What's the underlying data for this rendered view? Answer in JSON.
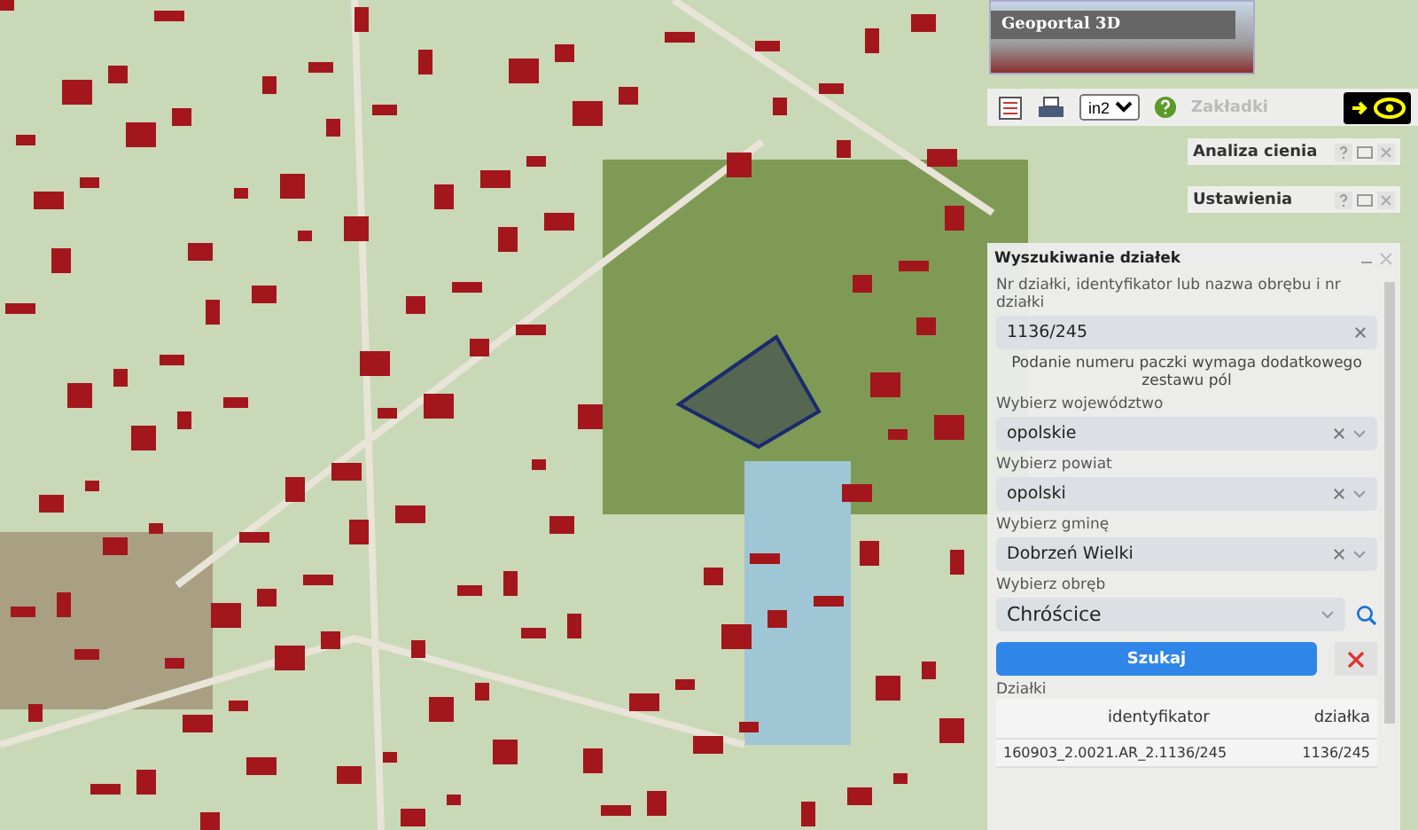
{
  "preview": {
    "title": "Geoportal 3D"
  },
  "toolbar": {
    "scale": "in2",
    "bookmarks_title": "Zakładki"
  },
  "panels": [
    {
      "title": "Analiza cienia"
    },
    {
      "title": "Ustawienia"
    }
  ],
  "search": {
    "title": "Wyszukiwanie działek",
    "query_label": "Nr działki, identyfikator lub nazwa obrębu i nr działki",
    "query": "1136/245",
    "hint": "Podanie numeru paczki wymaga dodatkowego zestawu pól",
    "fields": [
      {
        "label": "Wybierz województwo",
        "value": "opolskie",
        "kind": "clearable"
      },
      {
        "label": "Wybierz powiat",
        "value": "opolski",
        "kind": "clearable"
      },
      {
        "label": "Wybierz gminę",
        "value": "Dobrzeń Wielki",
        "kind": "clearable"
      },
      {
        "label": "Wybierz obręb",
        "value": "Chróścice",
        "kind": "searchable"
      }
    ],
    "search_button": "Szukaj",
    "results_label": "Działki",
    "table": {
      "columns": [
        "identyfikator",
        "działka"
      ],
      "rows": [
        [
          "160903_2.0021.AR_2.1136/245",
          "1136/245"
        ]
      ]
    }
  }
}
